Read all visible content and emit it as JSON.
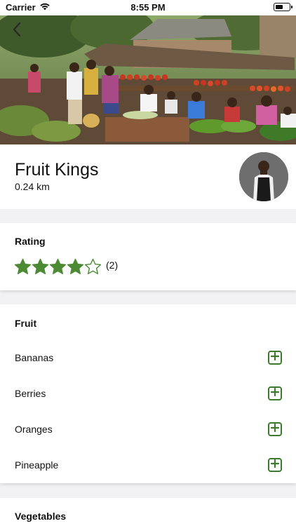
{
  "status_bar": {
    "carrier": "Carrier",
    "time": "8:55 PM"
  },
  "store": {
    "name": "Fruit Kings",
    "distance": "0.24 km"
  },
  "rating": {
    "title": "Rating",
    "value": 4,
    "max": 5,
    "count": "(2)"
  },
  "fruit": {
    "title": "Fruit",
    "items": [
      {
        "label": "Bananas"
      },
      {
        "label": "Berries"
      },
      {
        "label": "Oranges"
      },
      {
        "label": "Pineapple"
      }
    ]
  },
  "vegetables": {
    "title": "Vegetables"
  },
  "icons": {
    "back": "chevron-left-icon",
    "add": "plus-square-icon",
    "star": "star-icon",
    "wifi": "wifi-icon",
    "battery": "battery-icon"
  },
  "colors": {
    "accent": "#3d7a2e",
    "star": "#4c8a34",
    "background": "#f2f2f4"
  }
}
